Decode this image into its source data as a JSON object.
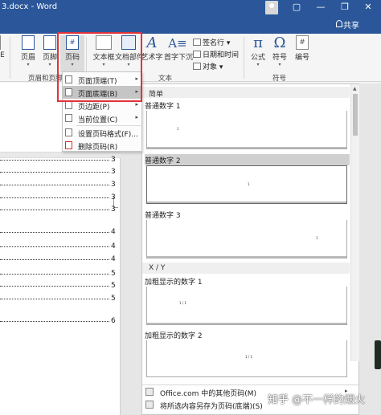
{
  "titlebar": {
    "title": "3.docx - Word",
    "buttons": [
      "▢",
      "—",
      "❐",
      "✕"
    ]
  },
  "tabrow": {
    "share_label": "共享"
  },
  "ribbon": {
    "buttons": {
      "header_short": "页眉",
      "footer_short": "页脚",
      "page_number": "页码",
      "text_box": "文本框",
      "doc_parts": "文档部件",
      "wordart": "艺术字",
      "dropcap": "首字下沉",
      "equation": "公式",
      "symbol": "符号",
      "number": "编号",
      "edge_left": "E"
    },
    "small_buttons": {
      "signature": "签名行",
      "datetime": "日期和时间",
      "object": "对象"
    },
    "groups": {
      "header_footer": "页眉和页脚",
      "text": "文本",
      "symbols": "符号",
      "left_fragment": "⊖"
    }
  },
  "menu": {
    "items": [
      {
        "label": "页面顶端(T)",
        "submenu": true
      },
      {
        "label": "页面底端(B)",
        "submenu": true
      },
      {
        "label": "页边距(P)",
        "submenu": true
      },
      {
        "label": "当前位置(C)",
        "submenu": true
      },
      {
        "label": "设置页码格式(F)...",
        "submenu": false
      },
      {
        "label": "删除页码(R)",
        "submenu": false
      }
    ]
  },
  "gallery": {
    "section_simple": "简单",
    "section_xy": "X / Y",
    "items": [
      {
        "title": "普通数字 1",
        "sample": "1"
      },
      {
        "title": "普通数字 2",
        "sample": "1"
      },
      {
        "title": "普通数字 3",
        "sample": "1"
      },
      {
        "title": "加粗显示的数字 1",
        "sample": "1 / 1"
      },
      {
        "title": "加粗显示的数字 2",
        "sample": "1 / 1"
      }
    ],
    "footer": {
      "more": "Office.com 中的其他页码(M)",
      "save": "将所选内容另存为页码(底端)(S)"
    }
  },
  "document": {
    "toc_numbers": [
      "3",
      "3",
      "3",
      "3",
      "3",
      "4",
      "4",
      "4",
      "5",
      "5",
      "5",
      "6"
    ]
  },
  "watermark": "知乎 @不一样的烟火"
}
